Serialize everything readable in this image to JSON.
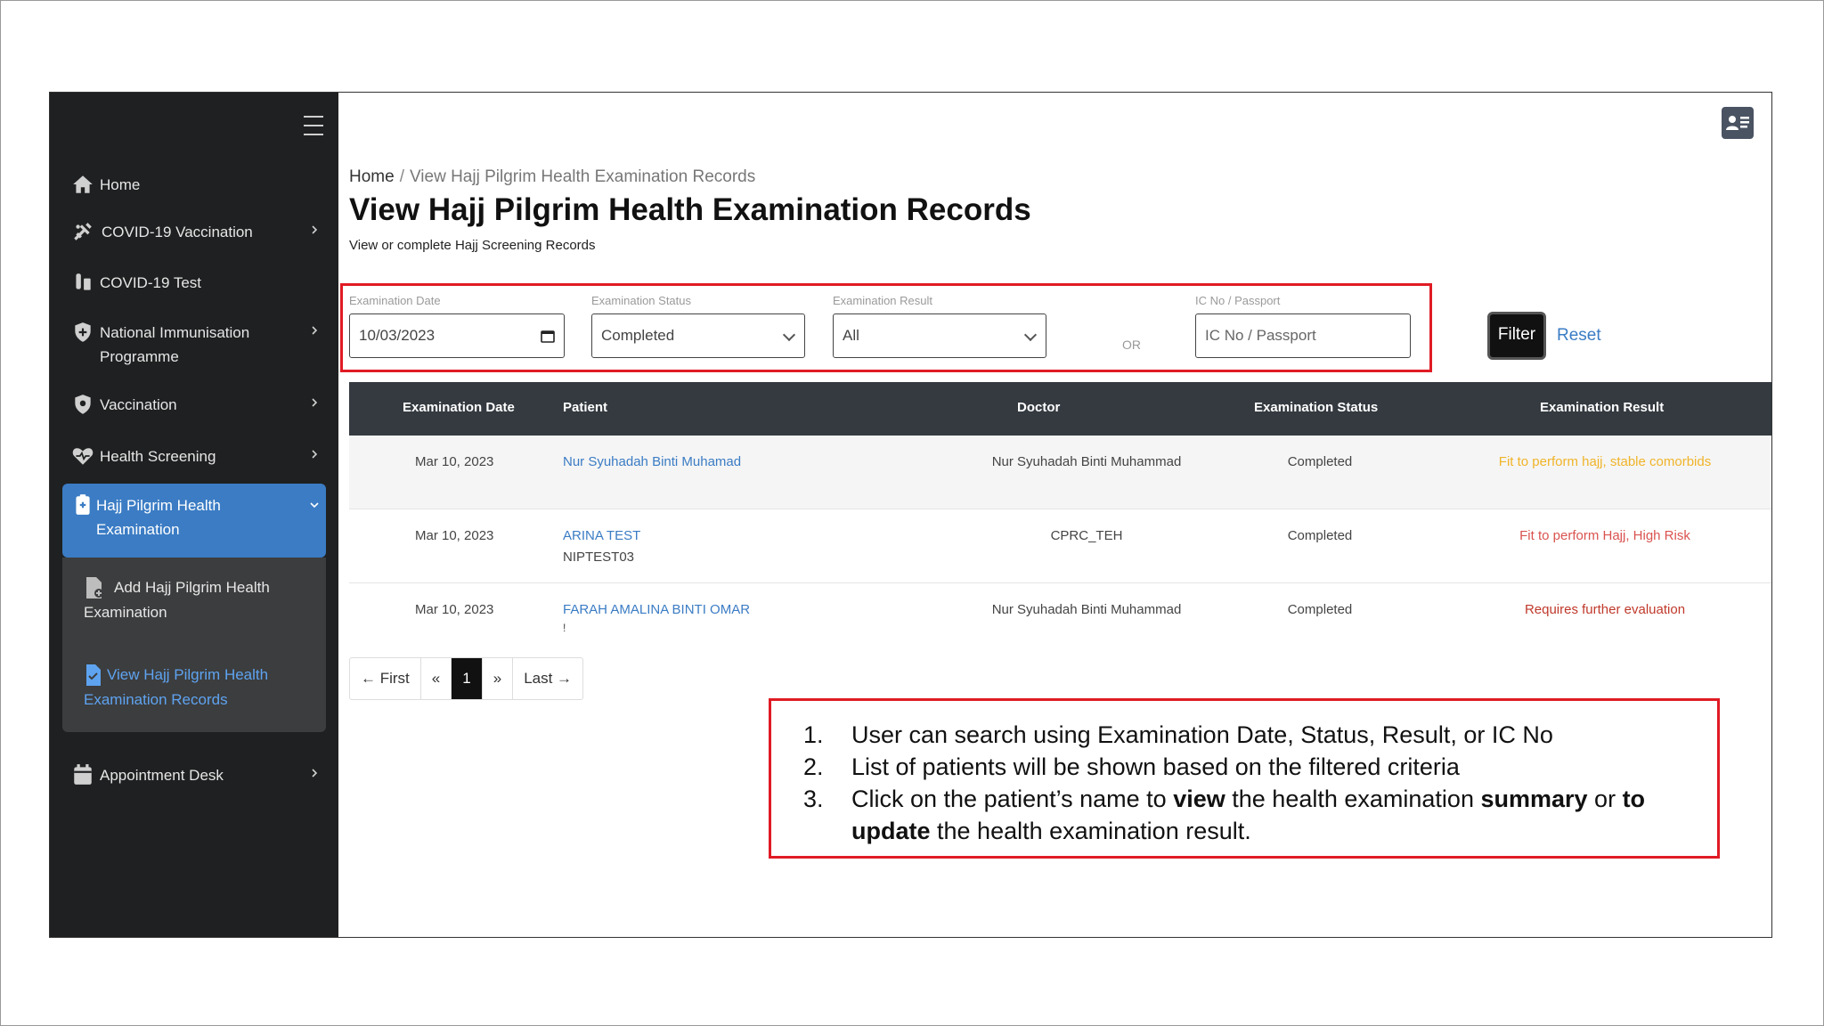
{
  "sidebar": {
    "items": [
      {
        "label": "Home"
      },
      {
        "label": "COVID-19 Vaccination"
      },
      {
        "label": "COVID-19 Test"
      },
      {
        "label": "National Immunisation Programme"
      },
      {
        "label": "Vaccination"
      },
      {
        "label": "Health Screening"
      },
      {
        "label": "Hajj Pilgrim Health Examination"
      },
      {
        "label": "Appointment Desk"
      }
    ],
    "subitems": [
      {
        "label": "Add Hajj Pilgrim Health Examination"
      },
      {
        "label": "View Hajj Pilgrim Health Examination Records"
      }
    ]
  },
  "breadcrumb": {
    "home": "Home",
    "separator": "/",
    "current": "View Hajj Pilgrim Health Examination Records"
  },
  "page": {
    "title": "View Hajj Pilgrim Health Examination Records",
    "subtitle": "View or complete Hajj Screening Records"
  },
  "filters": {
    "date_label": "Examination Date",
    "date_value": "10/03/2023",
    "status_label": "Examination Status",
    "status_value": "Completed",
    "result_label": "Examination Result",
    "result_value": "All",
    "or_text": "OR",
    "ic_label": "IC No / Passport",
    "ic_placeholder": "IC No / Passport",
    "filter_button": "Filter",
    "reset_link": "Reset"
  },
  "table": {
    "headers": [
      "Examination Date",
      "Patient",
      "Doctor",
      "Examination Status",
      "Examination Result"
    ],
    "rows": [
      {
        "date": "Mar 10, 2023",
        "patient": "Nur Syuhadah Binti Muhamad",
        "patient_id": "",
        "doctor": "Nur Syuhadah Binti Muhammad",
        "status": "Completed",
        "result": "Fit to perform hajj, stable comorbids",
        "result_color": "#f0b429"
      },
      {
        "date": "Mar 10, 2023",
        "patient": "ARINA TEST",
        "patient_id": "NIPTEST03",
        "doctor": "CPRC_TEH",
        "status": "Completed",
        "result": "Fit to perform Hajj, High Risk",
        "result_color": "#d9534f"
      },
      {
        "date": "Mar 10, 2023",
        "patient": "FARAH AMALINA BINTI OMAR",
        "patient_id": "!",
        "doctor": "Nur Syuhadah Binti Muhammad",
        "status": "Completed",
        "result": "Requires further evaluation",
        "result_color": "#c0392b"
      }
    ]
  },
  "pagination": {
    "first": "← First",
    "prev": "«",
    "current": "1",
    "next": "»",
    "last": "Last →"
  },
  "notes": {
    "item1_num": "1.",
    "item1": "User can search using Examination Date, Status, Result, or IC No",
    "item2_num": "2.",
    "item2": "List of patients will be shown based on the filtered criteria",
    "item3_num": "3.",
    "item3_a": "Click on the patient’s name to ",
    "item3_b": "view",
    "item3_c": " the health examination ",
    "item3_d": "summary",
    "item3_e": " or ",
    "item3_f": "to update",
    "item3_g": " the health examination result."
  },
  "colors": {
    "accent": "#3b7cc4",
    "sidebar": "#1f2021",
    "highlight_border": "#e01b24"
  }
}
